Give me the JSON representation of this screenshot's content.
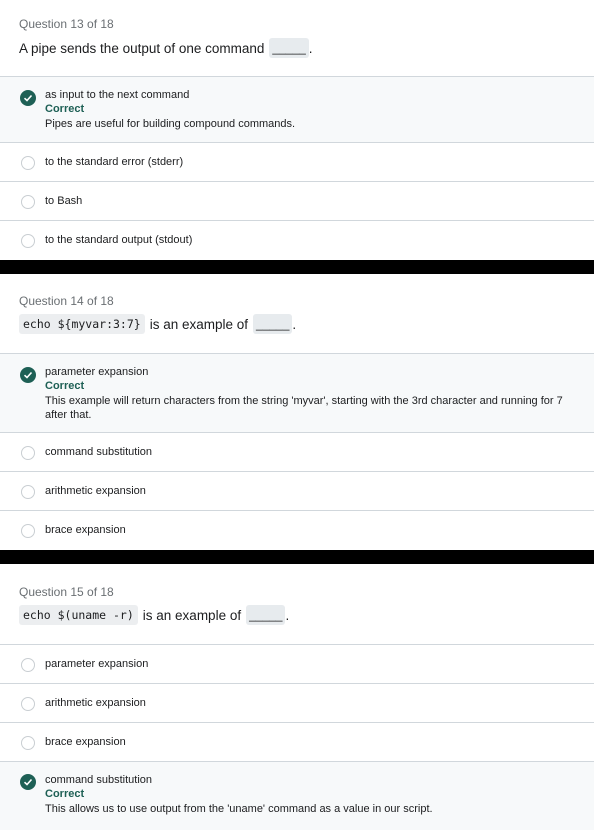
{
  "questions": [
    {
      "number": "Question 13 of 18",
      "prompt_before": "A pipe sends the output of one command",
      "blank": "_____",
      "prompt_after": ".",
      "options": [
        {
          "label": "as input to the next command",
          "correct": true,
          "status": "Correct",
          "explanation": "Pipes are useful for building compound commands."
        },
        {
          "label": "to the standard error (stderr)"
        },
        {
          "label": "to Bash"
        },
        {
          "label": "to the standard output (stdout)"
        }
      ]
    },
    {
      "number": "Question 14 of 18",
      "code": "echo ${myvar:3:7}",
      "prompt_before": "is an example of",
      "blank": "_____",
      "prompt_after": ".",
      "options": [
        {
          "label": "parameter expansion",
          "correct": true,
          "status": "Correct",
          "explanation": "This example will return characters from the string 'myvar', starting with the 3rd character and running for 7 after that."
        },
        {
          "label": "command substitution"
        },
        {
          "label": "arithmetic expansion"
        },
        {
          "label": "brace expansion"
        }
      ]
    },
    {
      "number": "Question 15 of 18",
      "code": "echo $(uname -r)",
      "prompt_before": "is an example of",
      "blank": "_____",
      "prompt_after": ".",
      "options": [
        {
          "label": "parameter expansion"
        },
        {
          "label": "arithmetic expansion"
        },
        {
          "label": "brace expansion"
        },
        {
          "label": "command substitution",
          "correct": true,
          "status": "Correct",
          "explanation": "This allows us to use output from the 'uname' command as a value in our script."
        }
      ]
    }
  ],
  "colors": {
    "correct": "#1e6055",
    "divider": "#000000",
    "border": "#d1d7dc"
  },
  "icons": {
    "correct": "check-circle-icon",
    "option": "radio-icon"
  }
}
